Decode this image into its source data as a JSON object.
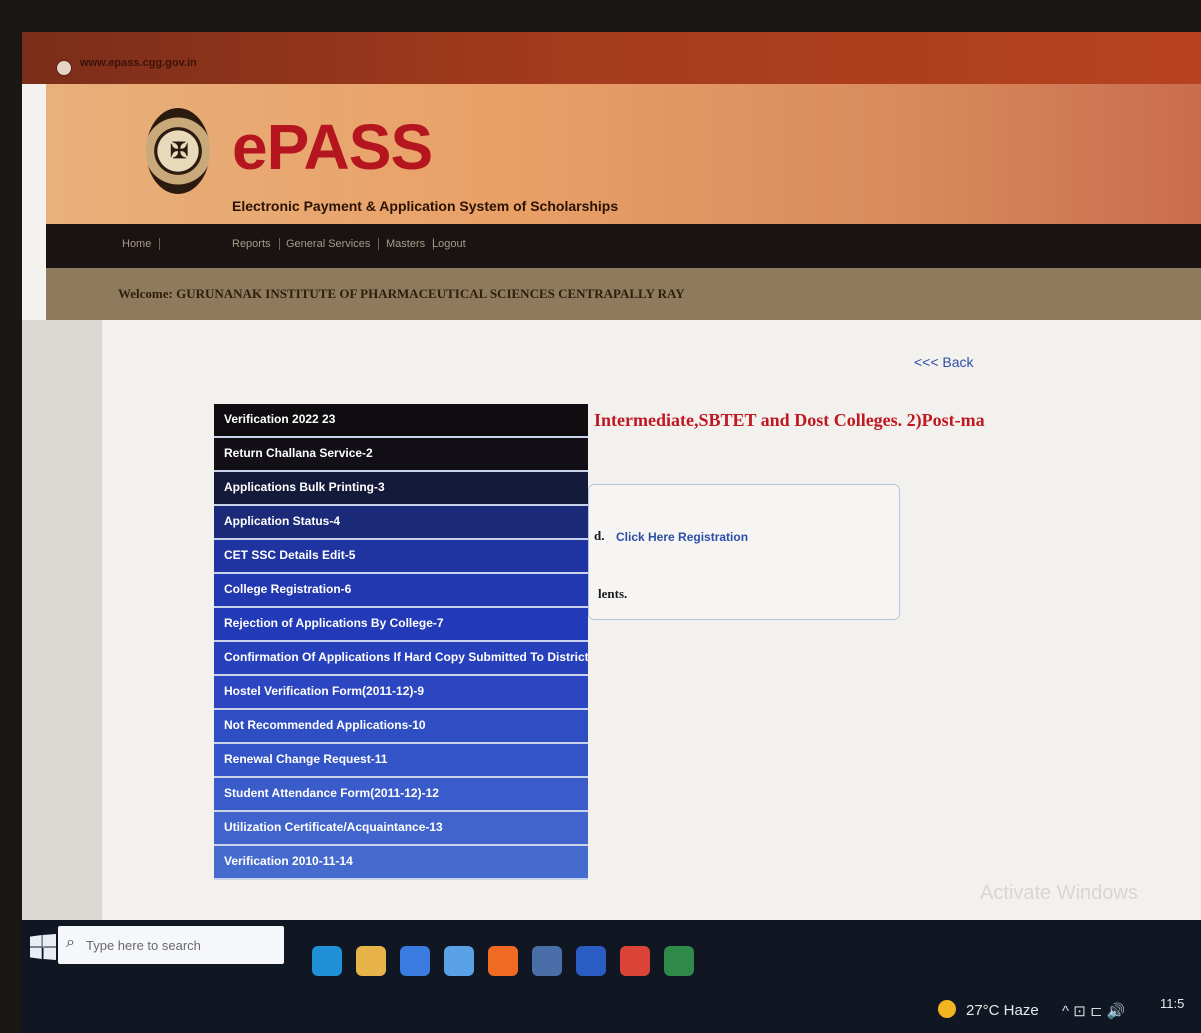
{
  "browser": {
    "url": "www.epass.cgg.gov.in"
  },
  "header": {
    "logo_mark": "✠",
    "brand": "ePASS",
    "subtitle": "Electronic Payment & Application System of Scholarships"
  },
  "nav": {
    "items": [
      "Home",
      "Reports",
      "General Services",
      "Masters",
      "Logout"
    ]
  },
  "welcome": "Welcome: GURUNANAK INSTITUTE OF PHARMACEUTICAL SCIENCES CENTRAPALLY RAY",
  "content": {
    "back_label": "<<< Back",
    "headline": "Intermediate,SBTET and Dost Colleges. 2)Post-ma",
    "line1_text": "d.",
    "registration_link": "Click Here Registration",
    "line2_text": "lents."
  },
  "menu": {
    "items": [
      "Verification 2022 23",
      "Return Challana Service-2",
      "Applications Bulk Printing-3",
      "Application Status-4",
      "CET SSC Details Edit-5",
      "College Registration-6",
      "Rejection of Applications By College-7",
      "Confirmation Of Applications If Hard Copy Submitted To District Officer By College",
      "Hostel Verification Form(2011-12)-9",
      "Not Recommended Applications-10",
      "Renewal Change Request-11",
      "Student Attendance Form(2011-12)-12",
      "Utilization Certificate/Acquaintance-13",
      "Verification 2010-11-14"
    ],
    "colors": [
      "#0f0d10",
      "#121016",
      "#131a3a",
      "#1b2a78",
      "#1f34a0",
      "#2238b0",
      "#233ab8",
      "#2740bc",
      "#2b46c0",
      "#2f4ec4",
      "#3455c8",
      "#3a5cca",
      "#4064cc",
      "#466bce"
    ]
  },
  "watermark": "Activate Windows",
  "taskbar": {
    "search_placeholder": "Type here to search",
    "weather": "27°C Haze",
    "tray_icons": "^  ⊡  ⊏  🔊",
    "clock": "11:5",
    "app_colors": [
      "#1f8fd6",
      "#e8b44a",
      "#3a7be0",
      "#5aa2e8",
      "#f06a24",
      "#4a6ea8",
      "#2b5cc4",
      "#d94436",
      "#2f8a4a"
    ]
  }
}
